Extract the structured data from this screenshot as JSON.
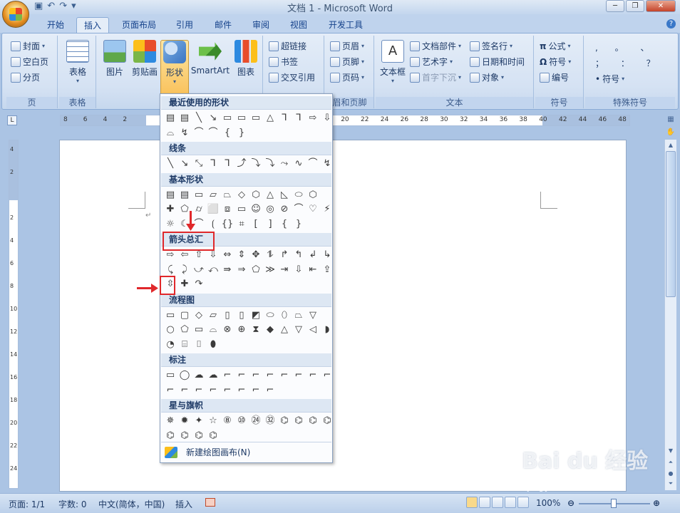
{
  "window": {
    "title": "文档 1 - Microsoft Word",
    "controls": [
      "─",
      "❐",
      "✕"
    ]
  },
  "tabs": [
    "开始",
    "插入",
    "页面布局",
    "引用",
    "邮件",
    "审阅",
    "视图",
    "开发工具"
  ],
  "active_tab": "插入",
  "ribbon": {
    "pages": {
      "items": [
        "封面",
        "空白页",
        "分页"
      ],
      "label": "页"
    },
    "tables": {
      "button": "表格",
      "label": "表格"
    },
    "illustrations": {
      "buttons": [
        "图片",
        "剪贴画",
        "形状",
        "SmartArt",
        "图表"
      ]
    },
    "links": {
      "items": [
        "超链接",
        "书签",
        "交叉引用"
      ]
    },
    "header_footer": {
      "items": [
        "页眉",
        "页脚",
        "页码"
      ],
      "label": "眉和页脚"
    },
    "text": {
      "textbox": "文本框",
      "items_col1": [
        "文档部件",
        "艺术字",
        "首字下沉"
      ],
      "items_col2": [
        "签名行",
        "日期和时间",
        "对象"
      ],
      "label": "文本"
    },
    "symbols": {
      "items": [
        "公式",
        "符号",
        "编号"
      ],
      "label": "符号"
    },
    "special": {
      "row1": ", 。 、",
      "row2": "； ： ？",
      "button": "符号",
      "label": "特殊符号"
    }
  },
  "ruler": {
    "h_ticks": [
      "8",
      "6",
      "4",
      "2",
      "",
      "2",
      "4",
      "6",
      "8",
      "10",
      "12",
      "14",
      "16",
      "18",
      "20",
      "22",
      "24",
      "26",
      "28",
      "30",
      "32",
      "34",
      "36",
      "38",
      "40",
      "42",
      "44",
      "46",
      "48"
    ],
    "v_ticks": [
      "4",
      "2",
      "",
      "2",
      "4",
      "6",
      "8",
      "10",
      "12",
      "14",
      "16",
      "18",
      "20",
      "22",
      "24"
    ]
  },
  "shapes_menu": {
    "sections": [
      {
        "title": "最近使用的形状",
        "rows": [
          [
            "▤",
            "▤",
            "╲",
            "↘",
            "▭",
            "▭",
            "▭",
            "△",
            "⅂",
            "⅂",
            "⇨",
            "⇩"
          ],
          [
            "⌓",
            "↯",
            "⌒",
            "⌒",
            "{",
            "}"
          ]
        ]
      },
      {
        "title": "线条",
        "rows": [
          [
            "╲",
            "↘",
            "⤡",
            "⅂",
            "⅂",
            "⤴",
            "⤵",
            "⤵",
            "⤳",
            "∿",
            "⌒",
            "↯"
          ]
        ]
      },
      {
        "title": "基本形状",
        "rows": [
          [
            "▤",
            "▤",
            "▭",
            "▱",
            "⏢",
            "◇",
            "⬡",
            "△",
            "◺",
            "⬭",
            "⬡"
          ],
          [
            "✚",
            "⬠",
            "⌭",
            "⬜",
            "⧈",
            "▭",
            "☺",
            "◎",
            "⊘",
            "⌒",
            "♡",
            "⚡"
          ],
          [
            "☼",
            "☾",
            "⌒",
            "⟮",
            "{}",
            "⌗",
            "[",
            "]",
            "{",
            "}"
          ]
        ]
      },
      {
        "title": "箭头总汇",
        "rows": [
          [
            "⇨",
            "⇦",
            "⇧",
            "⇩",
            "⇔",
            "⇕",
            "✥",
            "⥮",
            "↱",
            "↰",
            "↲",
            "↳"
          ],
          [
            "⤹",
            "⤸",
            "⤻",
            "⤺",
            "⇛",
            "⇒",
            "⬠",
            "≫",
            "⇥",
            "⇩",
            "⇤",
            "⇪"
          ],
          [
            "⇳",
            "✚",
            "↷"
          ]
        ]
      },
      {
        "title": "流程图",
        "rows": [
          [
            "▭",
            "▢",
            "◇",
            "▱",
            "▯",
            "▯",
            "◩",
            "⬭",
            "⬯",
            "⏢",
            "▽"
          ],
          [
            "○",
            "⬠",
            "▭",
            "⌓",
            "⊗",
            "⊕",
            "⧗",
            "◆",
            "△",
            "▽",
            "◁",
            "◗"
          ],
          [
            "◔",
            "⌸",
            "⌷",
            "⬮"
          ]
        ]
      },
      {
        "title": "标注",
        "rows": [
          [
            "▭",
            "◯",
            "☁",
            "☁",
            "⌐",
            "⌐",
            "⌐",
            "⌐",
            "⌐",
            "⌐",
            "⌐",
            "⌐"
          ],
          [
            "⌐",
            "⌐",
            "⌐",
            "⌐",
            "⌐",
            "⌐",
            "⌐",
            "⌐"
          ]
        ]
      },
      {
        "title": "星与旗帜",
        "rows": [
          [
            "✵",
            "✹",
            "✦",
            "☆",
            "⑧",
            "⑩",
            "㉔",
            "㉜",
            "⌬",
            "⌬",
            "⌬",
            "⌬"
          ],
          [
            "⌬",
            "⌬",
            "⌬",
            "⌬"
          ]
        ]
      }
    ],
    "new_canvas": "新建绘图画布(N)"
  },
  "status": {
    "page": "页面: 1/1",
    "words": "字数: 0",
    "lang": "中文(简体，中国)",
    "mode": "插入",
    "zoom": "100%",
    "zoom_value": 100
  },
  "watermark": {
    "brand": "Bai du 经验",
    "url": "jingyan.baidu.com"
  },
  "colors": {
    "annotation_red": "#e0282b",
    "ribbon_blue": "#bfd3ed"
  }
}
